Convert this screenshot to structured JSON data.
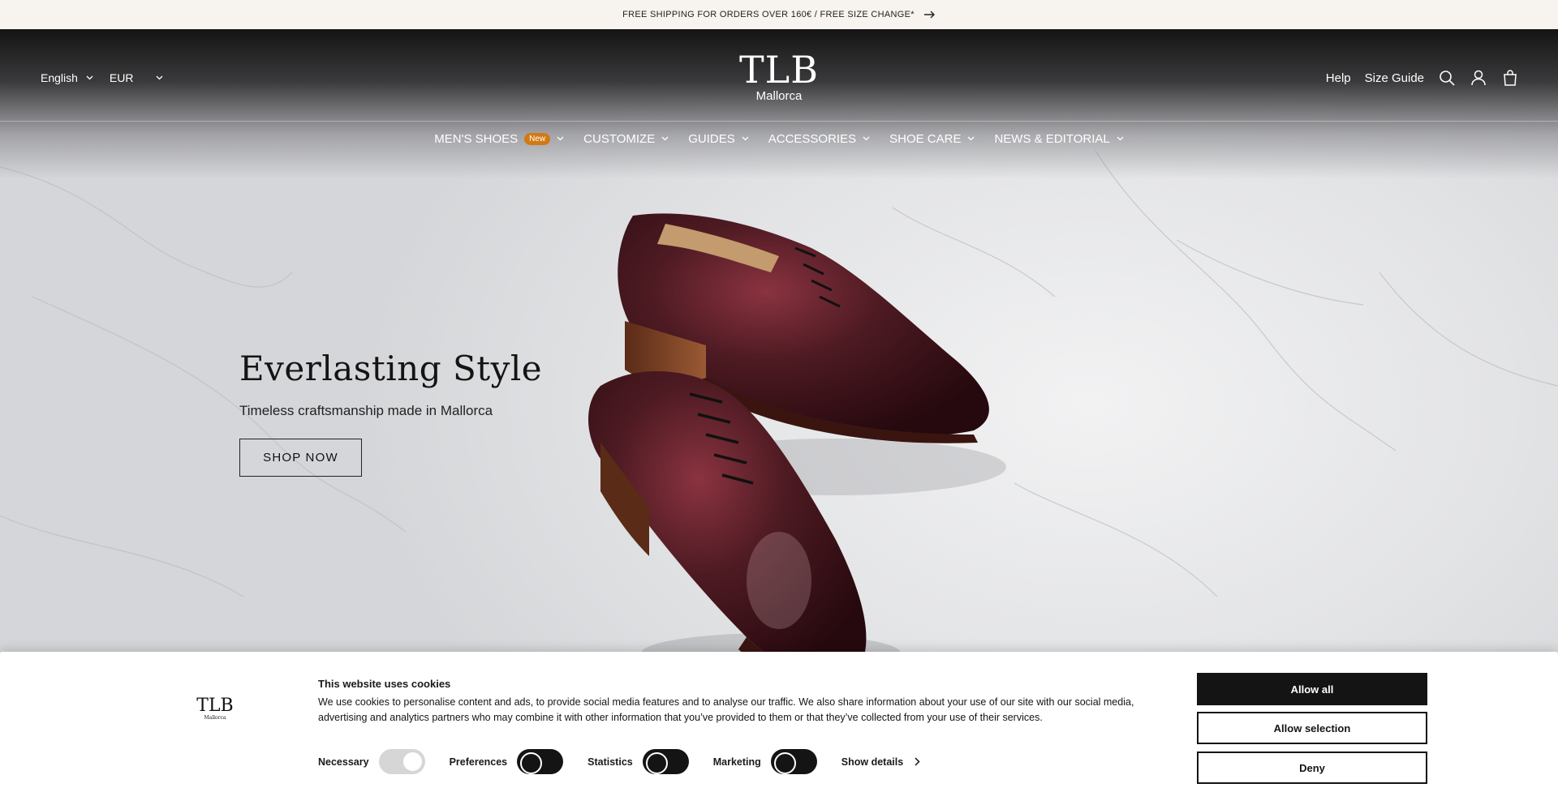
{
  "announcement": {
    "text": "FREE SHIPPING FOR ORDERS OVER 160€ / FREE SIZE CHANGE*"
  },
  "header": {
    "language": "English",
    "currency": "EUR",
    "logo": {
      "mark": "TLB",
      "sub": "Mallorca"
    },
    "links": {
      "help": "Help",
      "size_guide": "Size Guide"
    }
  },
  "nav": {
    "items": [
      {
        "label": "MEN'S SHOES",
        "badge": "New"
      },
      {
        "label": "CUSTOMIZE"
      },
      {
        "label": "GUIDES"
      },
      {
        "label": "ACCESSORIES"
      },
      {
        "label": "SHOE CARE"
      },
      {
        "label": "NEWS & EDITORIAL"
      }
    ]
  },
  "hero": {
    "title": "Everlasting Style",
    "subtitle": "Timeless craftsmanship made in Mallorca",
    "cta": "SHOP NOW"
  },
  "cookie": {
    "logo": {
      "mark": "TLB",
      "sub": "Mallorca"
    },
    "title": "This website uses cookies",
    "text": "We use cookies to personalise content and ads, to provide social media features and to analyse our traffic. We also share information about your use of our site with our social media, advertising and analytics partners who may combine it with other information that you’ve provided to them or that they’ve collected from your use of their services.",
    "consents": [
      {
        "label": "Necessary",
        "checked": true,
        "disabled": true
      },
      {
        "label": "Preferences",
        "checked": false
      },
      {
        "label": "Statistics",
        "checked": false
      },
      {
        "label": "Marketing",
        "checked": false
      }
    ],
    "show_details": "Show details",
    "buttons": {
      "allow_all": "Allow all",
      "allow_selection": "Allow selection",
      "deny": "Deny"
    }
  },
  "colors": {
    "badge": "#d17a14",
    "dark": "#141414",
    "announce_bg": "#f7f4ef"
  }
}
